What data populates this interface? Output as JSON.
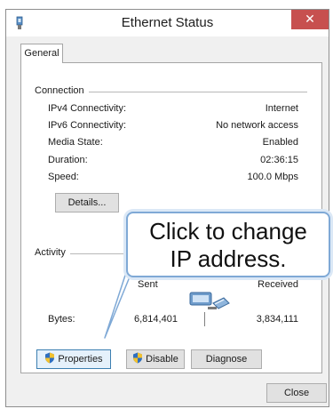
{
  "window": {
    "title": "Ethernet Status",
    "close_glyph": "✕"
  },
  "tab": {
    "label": "General"
  },
  "connection": {
    "group_label": "Connection",
    "rows": [
      {
        "label": "IPv4 Connectivity:",
        "value": "Internet"
      },
      {
        "label": "IPv6 Connectivity:",
        "value": "No network access"
      },
      {
        "label": "Media State:",
        "value": "Enabled"
      },
      {
        "label": "Duration:",
        "value": "02:36:15"
      },
      {
        "label": "Speed:",
        "value": "100.0 Mbps"
      }
    ],
    "details_button": "Details..."
  },
  "activity": {
    "group_label": "Activity",
    "sent_label": "Sent",
    "received_label": "Received",
    "bytes_label": "Bytes:",
    "bytes_sent": "6,814,401",
    "bytes_received": "3,834,111"
  },
  "buttons": {
    "properties": "Properties",
    "disable": "Disable",
    "diagnose": "Diagnose",
    "close": "Close"
  },
  "callout": {
    "line1": "Click to change",
    "line2": "IP address."
  },
  "icons": {
    "title": "network-adapter-icon",
    "shield": "uac-shield-icon",
    "network": "network-computers-icon"
  },
  "colors": {
    "close_button": "#c7504f",
    "callout_border": "#7fa9d6",
    "focus_border": "#3c7fb1"
  }
}
